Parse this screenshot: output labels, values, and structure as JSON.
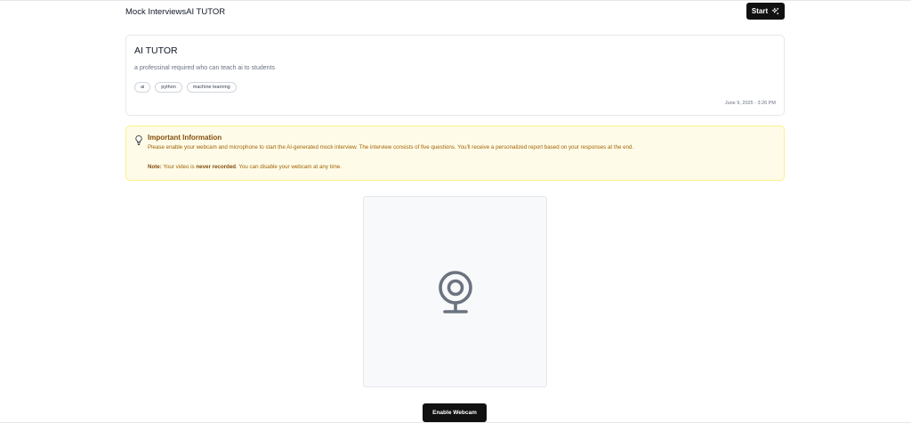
{
  "header": {
    "breadcrumb_parent": "Mock Interviews",
    "breadcrumb_current": "AI TUTOR",
    "start_label": "Start"
  },
  "interview": {
    "title": "AI TUTOR",
    "description": "a professinal required who can teach ai to students",
    "tags": [
      "ai",
      "python",
      "machine learning"
    ],
    "date": "June 9, 2025 - 3:26 PM"
  },
  "info": {
    "title": "Important Information",
    "text": "Please enable your webcam and microphone to start the AI-generated mock interview. The interview consists of five questions. You'll receive a personalized report based on your responses at the end.",
    "note_label": "Note:",
    "note_pre": " Your video is ",
    "note_bold": "never recorded",
    "note_post": ". You can disable your webcam at any time."
  },
  "webcam": {
    "icon": "webcam-icon",
    "enable_label": "Enable Webcam"
  },
  "colors": {
    "info_bg": "#fefce8",
    "info_text": "#a16207",
    "button_bg": "#111111"
  }
}
